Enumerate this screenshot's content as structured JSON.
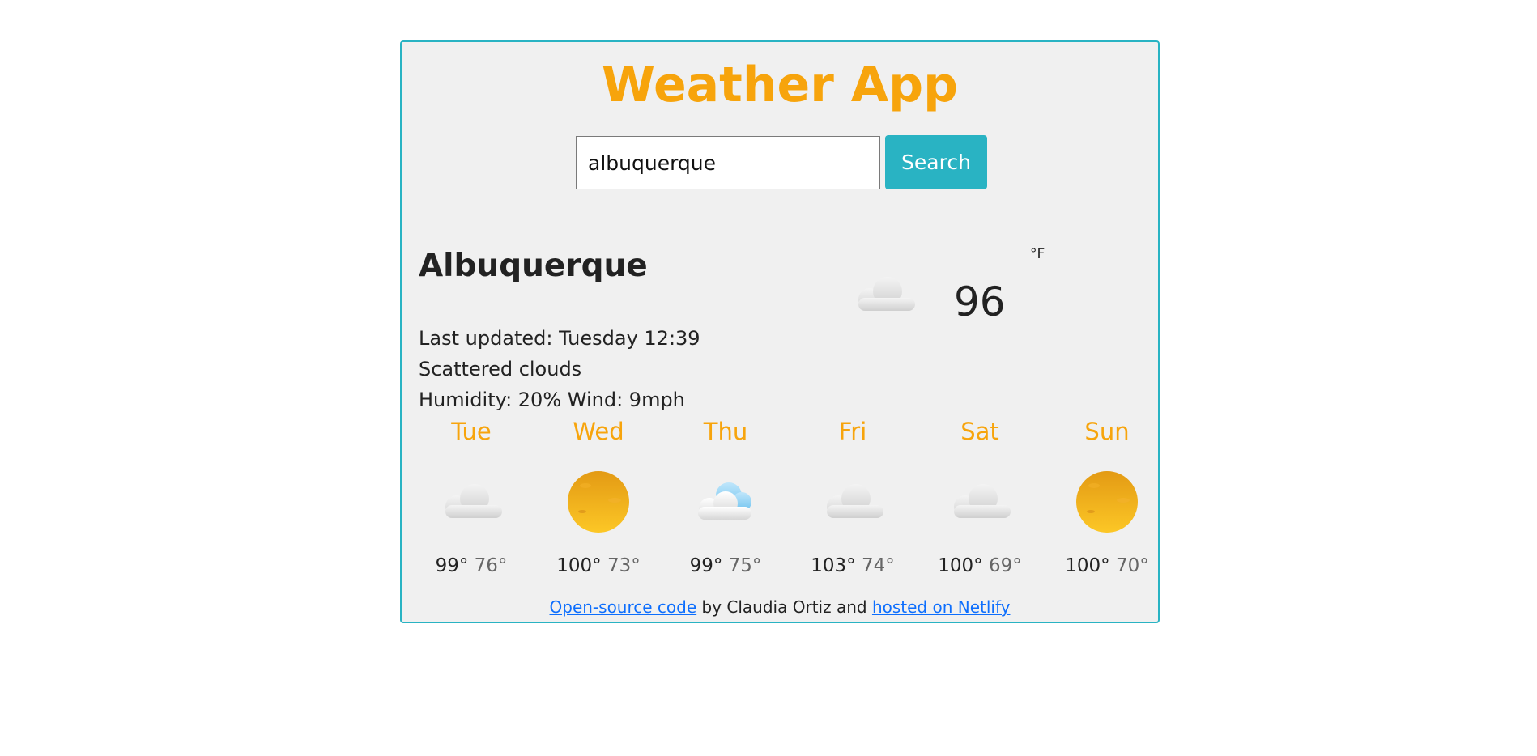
{
  "app": {
    "title": "Weather App"
  },
  "search": {
    "value": "albuquerque",
    "placeholder": "",
    "button_label": "Search"
  },
  "current": {
    "city": "Albuquerque",
    "last_updated": "Last updated: Tuesday 12:39",
    "description": "Scattered clouds",
    "humidity_wind": "Humidity: 20% Wind: 9mph",
    "temperature": "96",
    "unit": "°F",
    "icon": "cloud-icon"
  },
  "forecast": [
    {
      "day": "Tue",
      "icon": "cloud-icon",
      "high": "99°",
      "low": "76°"
    },
    {
      "day": "Wed",
      "icon": "sun-icon",
      "high": "100°",
      "low": "73°"
    },
    {
      "day": "Thu",
      "icon": "cloud-sun-icon",
      "high": "99°",
      "low": "75°"
    },
    {
      "day": "Fri",
      "icon": "cloud-icon",
      "high": "103°",
      "low": "74°"
    },
    {
      "day": "Sat",
      "icon": "cloud-icon",
      "high": "100°",
      "low": "69°"
    },
    {
      "day": "Sun",
      "icon": "sun-icon",
      "high": "100°",
      "low": "70°"
    }
  ],
  "footer": {
    "code_link": "Open-source code",
    "middle": "by Claudia Ortiz and",
    "host_link": "hosted on Netlify"
  },
  "colors": {
    "accent": "#f7a40c",
    "button": "#29b3c3",
    "border": "#29b3c3",
    "panel": "#f0f0f0",
    "link": "#0d6efd"
  }
}
